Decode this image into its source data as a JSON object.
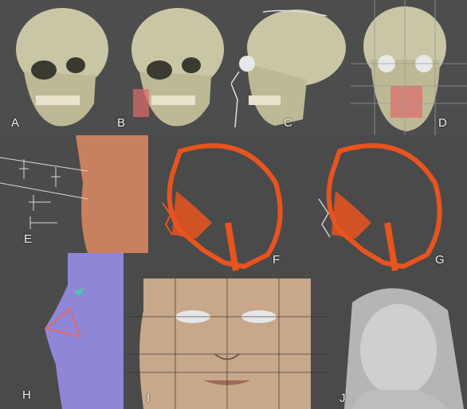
{
  "panels": {
    "A": {
      "label": "A"
    },
    "B": {
      "label": "B"
    },
    "C": {
      "label": "C"
    },
    "D": {
      "label": "D"
    },
    "E": {
      "label": "E"
    },
    "F": {
      "label": "F"
    },
    "G": {
      "label": "G"
    },
    "H": {
      "label": "H"
    },
    "I": {
      "label": "I"
    },
    "J": {
      "label": "J"
    }
  },
  "colors": {
    "background": "#4a4a4a",
    "bone": "#c9c6a6",
    "marker": "#e06a6a",
    "ct_orange": "#e8541e",
    "skin_orange": "#c8805e",
    "profile_purple": "#8f86d8",
    "face_tan": "#c7a88b",
    "render_gray": "#cfcfcf"
  }
}
